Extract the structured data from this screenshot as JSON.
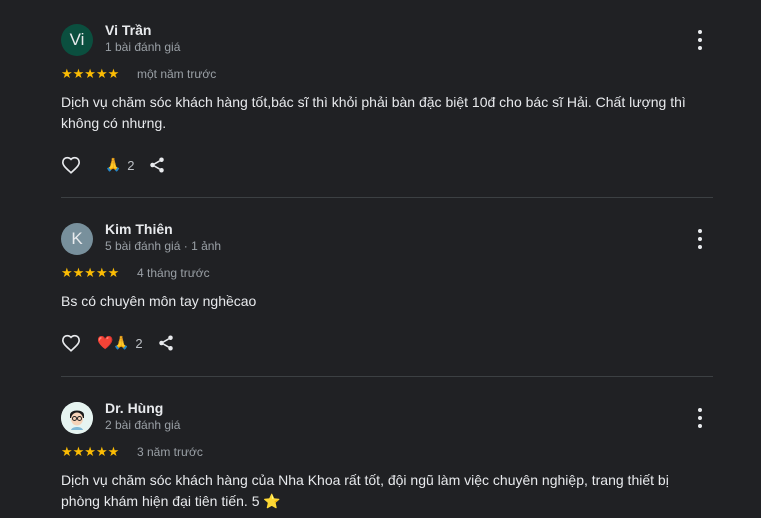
{
  "reviews": [
    {
      "avatar_letter": "Vi",
      "avatar_color": "#0b4f3f",
      "name": "Vi Trần",
      "meta": "1 bài đánh giá",
      "stars": "★★★★★",
      "when": "một năm trước",
      "text": "Dịch vụ chăm sóc khách hàng tốt,bác sĩ thì khỏi phải bàn đặc biệt 10đ cho bác sĩ Hải. Chất lượng thì không có nhưng.",
      "reaction_emoji": "🙏",
      "reaction_count": "2"
    },
    {
      "avatar_letter": "K",
      "avatar_color": "#78909c",
      "name": "Kim Thiên",
      "meta": "5 bài đánh giá · 1 ảnh",
      "stars": "★★★★★",
      "when": "4 tháng trước",
      "text": "Bs có chuyên môn tay nghềcao",
      "reaction_emoji": "❤️🙏",
      "reaction_count": "2"
    },
    {
      "avatar_letter": "",
      "avatar_color": "#e6f4f1",
      "name": "Dr. Hùng",
      "meta": "2 bài đánh giá",
      "stars": "★★★★★",
      "when": "3 năm trước",
      "text": "Dịch vụ chăm sóc khách hàng của Nha Khoa rất tốt, đội ngũ làm việc chuyên nghiệp, trang thiết bị phòng khám hiện đại tiên tiến. 5 ⭐"
    }
  ],
  "colors": {
    "star": "#fbbc04",
    "background": "#202124"
  }
}
